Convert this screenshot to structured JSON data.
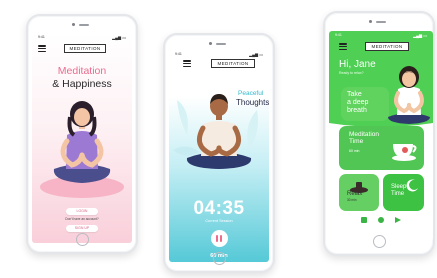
{
  "common": {
    "time": "9:41",
    "signal": "▂▄▆ ▭"
  },
  "phone1": {
    "tag": "MEDITATION",
    "title_line1": "Meditation",
    "title_line2": "& Happiness",
    "login_label": "LOGIN",
    "no_account_text": "Don't have an account?",
    "signup_label": "SIGN UP"
  },
  "phone2": {
    "tag": "MEDITATION",
    "peaceful": "Peaceful",
    "thoughts": "Thoughts",
    "timer": "04:35",
    "current_session": "Current Session",
    "duration": "60 min"
  },
  "phone3": {
    "tag": "MEDITATION",
    "greeting": "Hi, Jane",
    "ready_text": "Ready to relax?",
    "card_breath_line1": "Take",
    "card_breath_line2": "a deep",
    "card_breath_line3": "breath",
    "card_meditation_line1": "Meditation",
    "card_meditation_line2": "Time",
    "card_meditation_duration": "60 min",
    "card_relax_title": "Relax",
    "card_relax_duration": "30 min",
    "card_sleep_line1": "Sleep",
    "card_sleep_line2": "Time"
  },
  "colors": {
    "pink": "#ea6c8f",
    "teal": "#34b9cd",
    "green": "#3ab545"
  }
}
